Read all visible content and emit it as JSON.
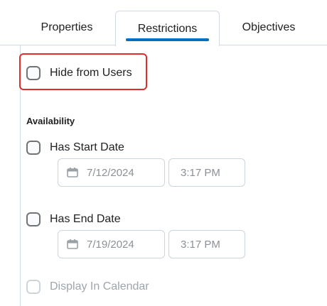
{
  "tabs": {
    "properties": "Properties",
    "restrictions": "Restrictions",
    "objectives": "Objectives",
    "active": "Restrictions"
  },
  "visibility": {
    "hide_label": "Hide from Users",
    "hide_checked": false
  },
  "availability": {
    "heading": "Availability",
    "start": {
      "label": "Has Start Date",
      "checked": false,
      "date": "7/12/2024",
      "time": "3:17 PM"
    },
    "end": {
      "label": "Has End Date",
      "checked": false,
      "date": "7/19/2024",
      "time": "3:17 PM"
    },
    "calendar": {
      "label": "Display In Calendar",
      "checked": false,
      "disabled": true
    }
  },
  "colors": {
    "accent": "#006fbf",
    "highlight": "#e32b2b",
    "border": "#d3d9e3",
    "muted_text": "#8b9196"
  },
  "icons": {
    "date_field": "calendar-icon"
  }
}
